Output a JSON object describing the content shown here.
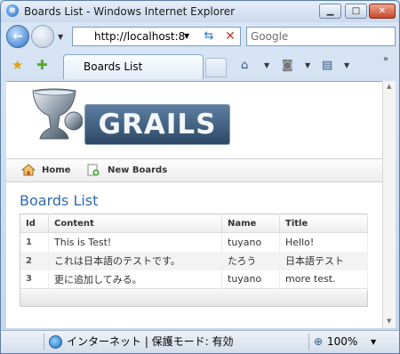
{
  "window": {
    "title": "Boards List - Windows Internet Explorer",
    "minimize_label": "▁",
    "maximize_label": "□",
    "close_label": "✕"
  },
  "address_bar": {
    "url": "http://localhost:8",
    "search_text": "Google"
  },
  "tab": {
    "title": "Boards List"
  },
  "page": {
    "logo_text": "GRAILS",
    "nav": {
      "home": "Home",
      "new_boards": "New Boards"
    },
    "heading": "Boards List",
    "table": {
      "columns": [
        "Id",
        "Content",
        "Name",
        "Title"
      ],
      "rows": [
        {
          "id": "1",
          "content": "This is Test!",
          "name": "tuyano",
          "title": "Hello!"
        },
        {
          "id": "2",
          "content": "これは日本語のテストです。",
          "name": "たろう",
          "title": "日本語テスト"
        },
        {
          "id": "3",
          "content": "更に追加してみる。",
          "name": "tuyano",
          "title": "more test."
        }
      ]
    }
  },
  "status_bar": {
    "zone": "インターネット | 保護モード: 有効",
    "zoom": "100%"
  },
  "icons": [
    "ie-logo-icon",
    "back-icon",
    "forward-icon",
    "page-icon",
    "refresh-icon",
    "stop-icon",
    "favorites-star-icon",
    "add-favorites-icon",
    "home-toolbar-icon",
    "rss-icon",
    "print-icon",
    "home-icon",
    "new-boards-icon",
    "globe-icon",
    "zoom-icon"
  ],
  "colors": {
    "heading": "#2e6ab1",
    "chrome": "#cfdcec"
  }
}
